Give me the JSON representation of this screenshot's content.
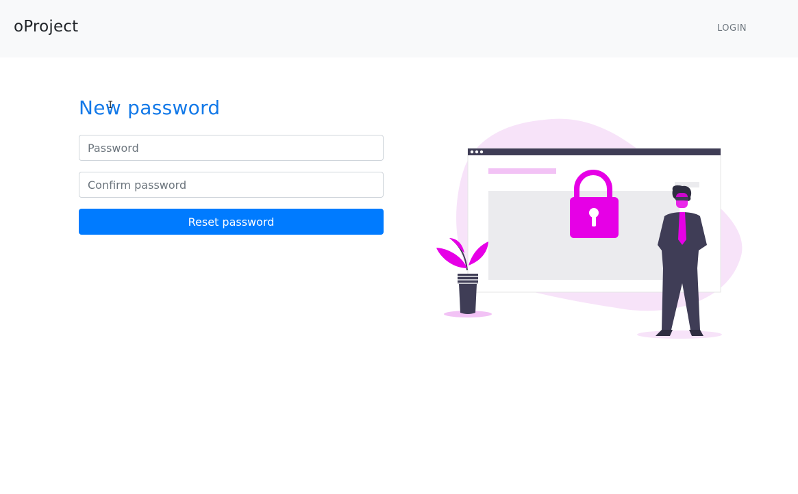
{
  "navbar": {
    "brand": "oProject",
    "login_label": "LOGIN"
  },
  "form": {
    "title": "New password",
    "password_placeholder": "Password",
    "confirm_placeholder": "Confirm password",
    "submit_label": "Reset password"
  },
  "colors": {
    "accent": "#007bff",
    "title": "#1379e8",
    "navbar_bg": "#f8f9fa",
    "illustration_primary": "#e600e6",
    "illustration_dark": "#3f3d56"
  },
  "illustration": {
    "icons": [
      "lock-icon",
      "browser-window",
      "person",
      "potted-plant"
    ]
  }
}
